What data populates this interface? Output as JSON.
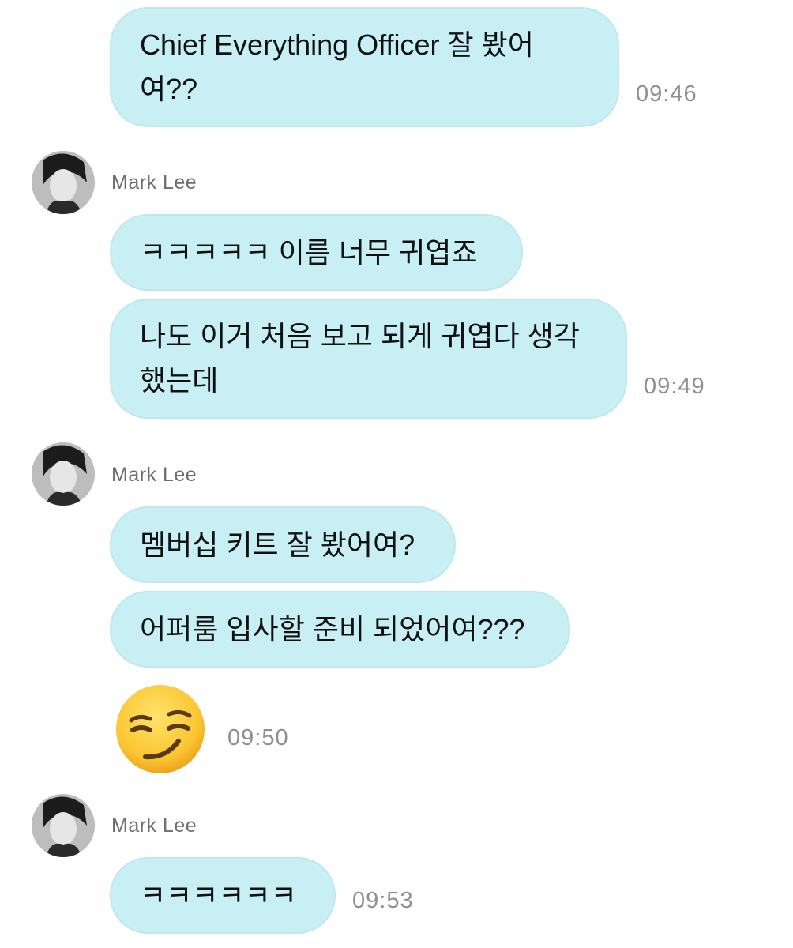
{
  "messages": {
    "m1": {
      "text": "Chief Everything Officer 잘 봤어\n여??",
      "time": "09:46"
    },
    "g1": {
      "sender": "Mark Lee",
      "m2": {
        "text": "ㅋㅋㅋㅋㅋ 이름 너무 귀엽죠"
      },
      "m3": {
        "text": "나도 이거 처음 보고 되게 귀엽다 생각\n했는데",
        "time": "09:49"
      }
    },
    "g2": {
      "sender": "Mark Lee",
      "m4": {
        "text": "멤버십 키트 잘 봤어여?"
      },
      "m5": {
        "text": "어퍼룸 입사할 준비 되었어여???"
      },
      "m6": {
        "emoji": "smirking-face",
        "time": "09:50"
      }
    },
    "g3": {
      "sender": "Mark Lee",
      "m7": {
        "text": "ㅋㅋㅋㅋㅋㅋ",
        "time": "09:53"
      }
    }
  },
  "colors": {
    "bubble": "#c8f0f4",
    "bubble_border": "#bfe7ee",
    "timestamp": "#8e8e93",
    "sender": "#6d6d72"
  }
}
